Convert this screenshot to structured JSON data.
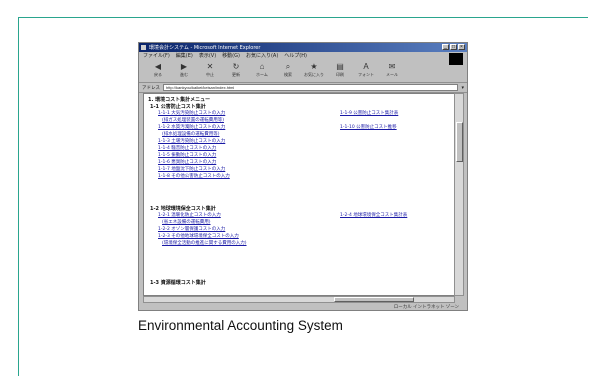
{
  "caption": "Environmental Accounting System",
  "window": {
    "title": "環境会計システム - Microsoft Internet Explorer",
    "menu": [
      "ファイル(F)",
      "編集(E)",
      "表示(V)",
      "移動(G)",
      "お気に入り(A)",
      "ヘルプ(H)"
    ],
    "toolbar": [
      {
        "icon": "back-icon",
        "glyph": "◀",
        "label": "戻る"
      },
      {
        "icon": "forward-icon",
        "glyph": "▶",
        "label": "進む"
      },
      {
        "icon": "stop-icon",
        "glyph": "✕",
        "label": "中止"
      },
      {
        "icon": "refresh-icon",
        "glyph": "↻",
        "label": "更新"
      },
      {
        "icon": "home-icon",
        "glyph": "⌂",
        "label": "ホーム"
      },
      {
        "icon": "search-icon",
        "glyph": "⌕",
        "label": "検索"
      },
      {
        "icon": "favorites-icon",
        "glyph": "★",
        "label": "お気に入り"
      },
      {
        "icon": "print-icon",
        "glyph": "▤",
        "label": "印刷"
      },
      {
        "icon": "font-icon",
        "glyph": "A",
        "label": "フォント"
      },
      {
        "icon": "mail-icon",
        "glyph": "✉",
        "label": "メール"
      }
    ],
    "address_label": "アドレス",
    "address_value": "http://kankyou/kaikei/keisan/index.html",
    "status_left": "",
    "status_zone": "ローカル イントラネット ゾーン"
  },
  "content": {
    "heading": "1. 環境コスト集計メニュー",
    "sections": [
      {
        "title": "1-1 公害防止コスト集計",
        "links": [
          "1-1-1 大気汚染防止コストの入力",
          "(排ガス処理装置の運転費用等)",
          "1-1-2 水質汚濁防止コストの入力",
          "(排水処理設備の運転費用等)",
          "1-1-3 土壌汚染防止コストの入力",
          "1-1-4 騒音防止コストの入力",
          "1-1-5 振動防止コストの入力",
          "1-1-6 悪臭防止コストの入力",
          "1-1-7 地盤沈下防止コストの入力",
          "1-1-8 その他公害防止コストの入力"
        ],
        "side_links": [
          "1-1-9 公害防止コスト集計表",
          "1-1-10 公害防止コスト推移"
        ]
      },
      {
        "title": "1-2 地球環境保全コスト集計",
        "links": [
          "1-2-1 温暖化防止コストの入力",
          "(省エネ設備の運転費用)",
          "1-2-2 オゾン層保護コストの入力",
          "1-2-3 その他地球環境保全コストの入力",
          "(環境保全活動の推進に関する費用の入力)"
        ],
        "side_links": [
          "1-2-4 地球環境保全コスト集計表"
        ]
      },
      {
        "title": "1-3 資源循環コスト集計",
        "links": [],
        "side_links": []
      }
    ]
  },
  "colors": {
    "frame": "#2aa58e",
    "link": "#1a1aa6",
    "titlebar": "#0a246a"
  }
}
